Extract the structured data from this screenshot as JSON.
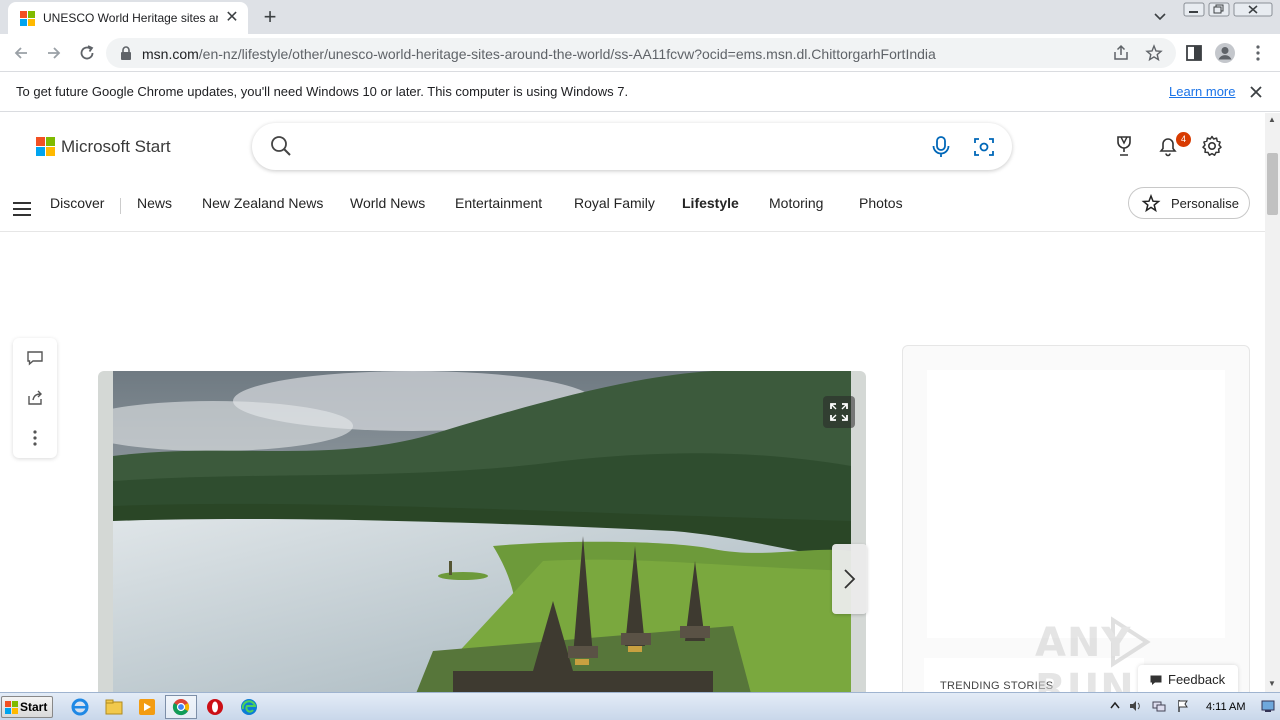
{
  "browser": {
    "tab_title": "UNESCO World Heritage sites around the world",
    "tab_close": "✕",
    "new_tab": "+",
    "url_host": "msn.com",
    "url_path": "/en-nz/lifestyle/other/unesco-world-heritage-sites-around-the-world/ss-AA11fcvw?ocid=ems.msn.dl.ChittorgarhFortIndia",
    "info_message": "To get future Google Chrome updates, you'll need Windows 10 or later. This computer is using Windows 7.",
    "info_link": "Learn more"
  },
  "msn": {
    "brand": "Microsoft Start",
    "notification_count": "4",
    "nav": [
      "Discover",
      "News",
      "New Zealand News",
      "World News",
      "Entertainment",
      "Royal Family",
      "Lifestyle",
      "Motoring",
      "Photos"
    ],
    "active_nav": "Lifestyle",
    "personalise": "Personalise",
    "trending_label": "TRENDING STORIES",
    "feedback": "Feedback"
  },
  "watermark": "ANY RUN",
  "taskbar": {
    "start": "Start",
    "clock": "4:11 AM"
  },
  "colors": {
    "ms_red": "#f25022",
    "ms_green": "#7fba00",
    "ms_blue": "#00a4ef",
    "ms_yellow": "#ffb900",
    "link": "#1a73e8",
    "badge": "#d83b01",
    "icon_blue": "#0067b8"
  }
}
